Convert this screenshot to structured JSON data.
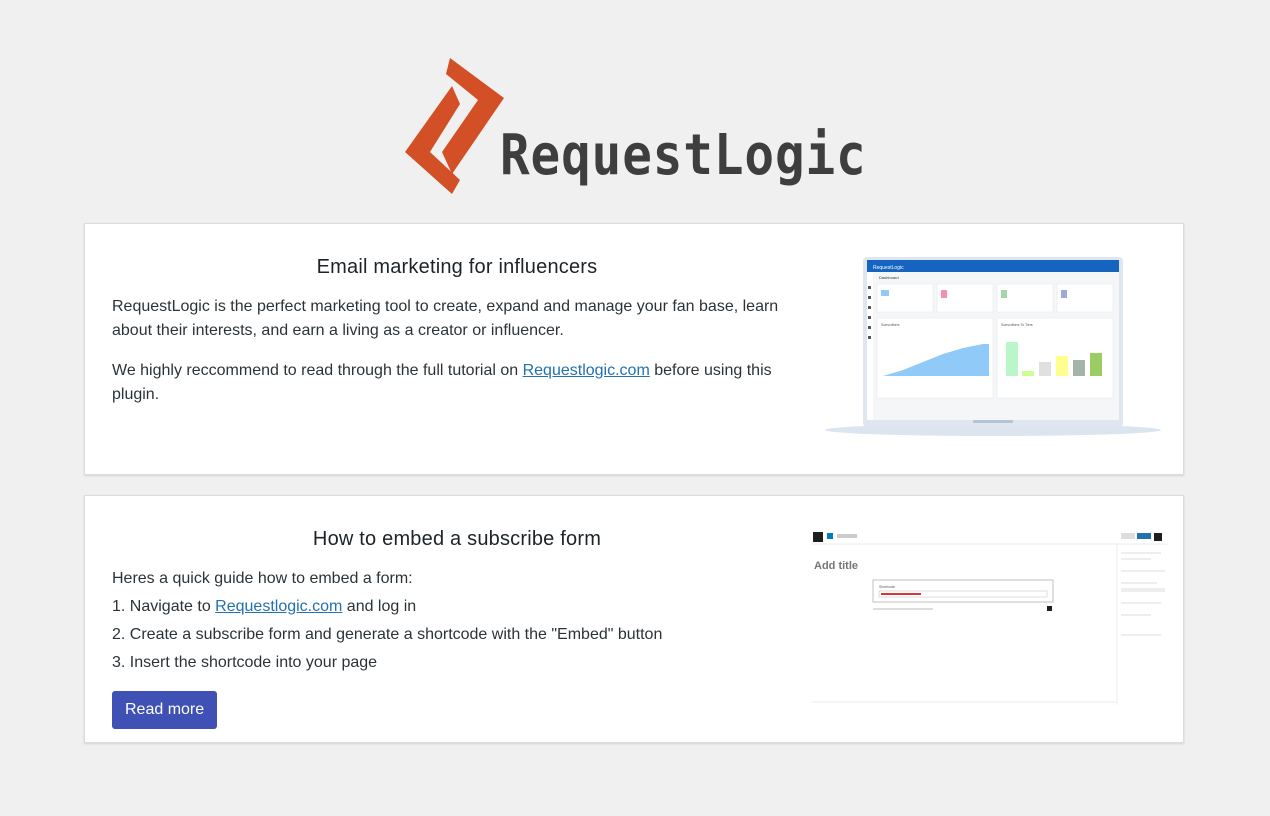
{
  "brand": {
    "name": "RequestLogic",
    "accent": "#d35027"
  },
  "card1": {
    "title": "Email marketing for influencers",
    "para1": "RequestLogic is the perfect marketing tool to create, expand and manage your fan base, learn about their interests, and earn a living as a creator or influencer.",
    "para2_before": "We highly reccommend to read through the full tutorial on ",
    "para2_link": "Requestlogic.com",
    "para2_after": " before using this plugin.",
    "screenshot": {
      "app_name": "RequestLogic",
      "page": "Dashboard",
      "chart1_title": "Subscribers",
      "chart2_title": "Subscribers To Tiers"
    }
  },
  "card2": {
    "title": "How to embed a subscribe form",
    "intro": "Heres a quick guide how to embed a form:",
    "step1_before": "1. Navigate to ",
    "step1_link": "Requestlogic.com",
    "step1_after": " and log in",
    "step2": "2. Create a subscribe form and generate a shortcode with the \"Embed\" button",
    "step3": "3. Insert the shortcode into your page",
    "button": "Read more",
    "screenshot": {
      "editor_title": "Add title",
      "block_label": "Shortcode"
    }
  },
  "colors": {
    "button": "#3f51b5",
    "link": "#2271b1",
    "background": "#f0f0f1"
  }
}
